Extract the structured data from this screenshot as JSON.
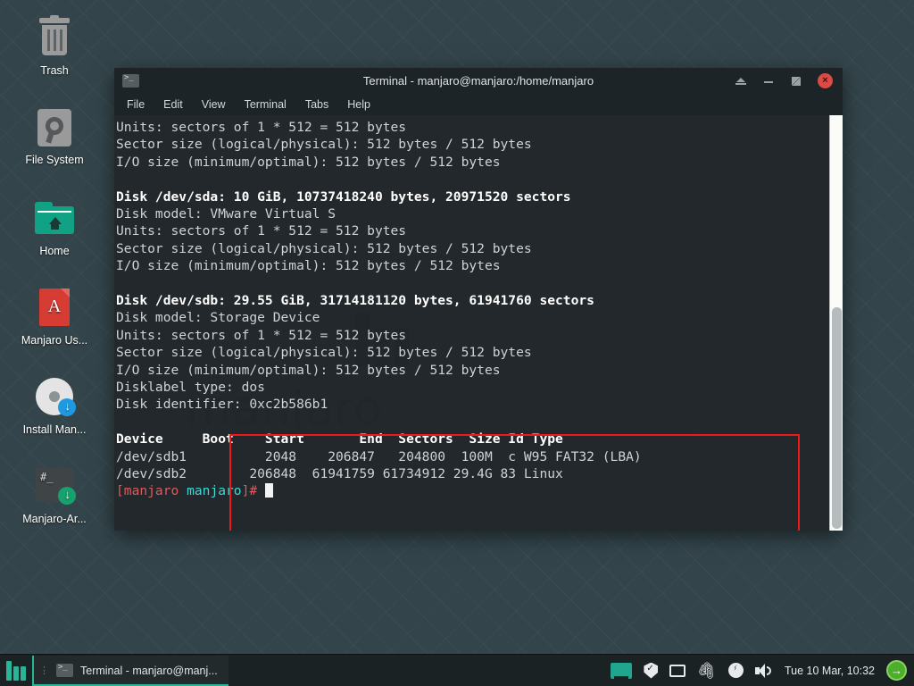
{
  "desktop": {
    "icons": [
      {
        "label": "Trash",
        "icon": "trash-icon"
      },
      {
        "label": "File System",
        "icon": "drive-icon"
      },
      {
        "label": "Home",
        "icon": "home-folder-icon"
      },
      {
        "label": "Manjaro Us...",
        "icon": "pdf-document-icon"
      },
      {
        "label": "Install Man...",
        "icon": "installer-disc-icon"
      },
      {
        "label": "Manjaro-Ar...",
        "icon": "architect-terminal-icon"
      }
    ],
    "watermark_text": "manjaro"
  },
  "terminal": {
    "title": "Terminal - manjaro@manjaro:/home/manjaro",
    "titlebar_icon": "terminal-icon",
    "window_buttons": [
      {
        "name": "shade-button",
        "glyph": "shade"
      },
      {
        "name": "minimize-button",
        "glyph": "minimize"
      },
      {
        "name": "maximize-button",
        "glyph": "maximize"
      },
      {
        "name": "close-button",
        "glyph": "×"
      }
    ],
    "menu": [
      "File",
      "Edit",
      "View",
      "Terminal",
      "Tabs",
      "Help"
    ],
    "accent_red": "#f21818",
    "lines_top": [
      "Units: sectors of 1 * 512 = 512 bytes",
      "Sector size (logical/physical): 512 bytes / 512 bytes",
      "I/O size (minimum/optimal): 512 bytes / 512 bytes",
      "",
      "Disk /dev/sda: 10 GiB, 10737418240 bytes, 20971520 sectors",
      "Disk model: VMware Virtual S",
      "Units: sectors of 1 * 512 = 512 bytes",
      "Sector size (logical/physical): 512 bytes / 512 bytes",
      "I/O size (minimum/optimal): 512 bytes / 512 bytes",
      ""
    ],
    "lines_top_bold": [
      4
    ],
    "lines_highlighted": [
      "Disk /dev/sdb: 29.55 GiB, 31714181120 bytes, 61941760 sectors",
      "Disk model: Storage Device",
      "Units: sectors of 1 * 512 = 512 bytes",
      "Sector size (logical/physical): 512 bytes / 512 bytes",
      "I/O size (minimum/optimal): 512 bytes / 512 bytes",
      "Disklabel type: dos",
      "Disk identifier: 0xc2b586b1"
    ],
    "lines_highlighted_bold": [
      0
    ],
    "spacer_after_highlight": "",
    "partition_header": "Device     Boot    Start       End  Sectors  Size Id Type",
    "partition_rows": [
      "/dev/sdb1          2048    206847   204800  100M  c W95 FAT32 (LBA)",
      "/dev/sdb2        206848  61941759 61734912 29.4G 83 Linux"
    ],
    "prompt": {
      "part1": "[manjaro",
      "part2": " manjaro",
      "part3": "]# ",
      "part1_color": "#e05a5a",
      "part2_color": "#3fd8d6",
      "part3_color": "#e05a5a"
    }
  },
  "taskbar": {
    "menu_button": "manjaro-menu-button",
    "items": [
      {
        "label": "Terminal - manjaro@manj...",
        "icon": "terminal-icon"
      }
    ],
    "tray": [
      {
        "name": "display-settings-icon"
      },
      {
        "name": "security-shield-icon"
      },
      {
        "name": "screen-icon"
      },
      {
        "name": "clipboard-paperclip-icon"
      },
      {
        "name": "power-manager-icon"
      },
      {
        "name": "volume-speaker-icon"
      }
    ],
    "clock": "Tue 10 Mar, 10:32",
    "logout_button": "→"
  }
}
